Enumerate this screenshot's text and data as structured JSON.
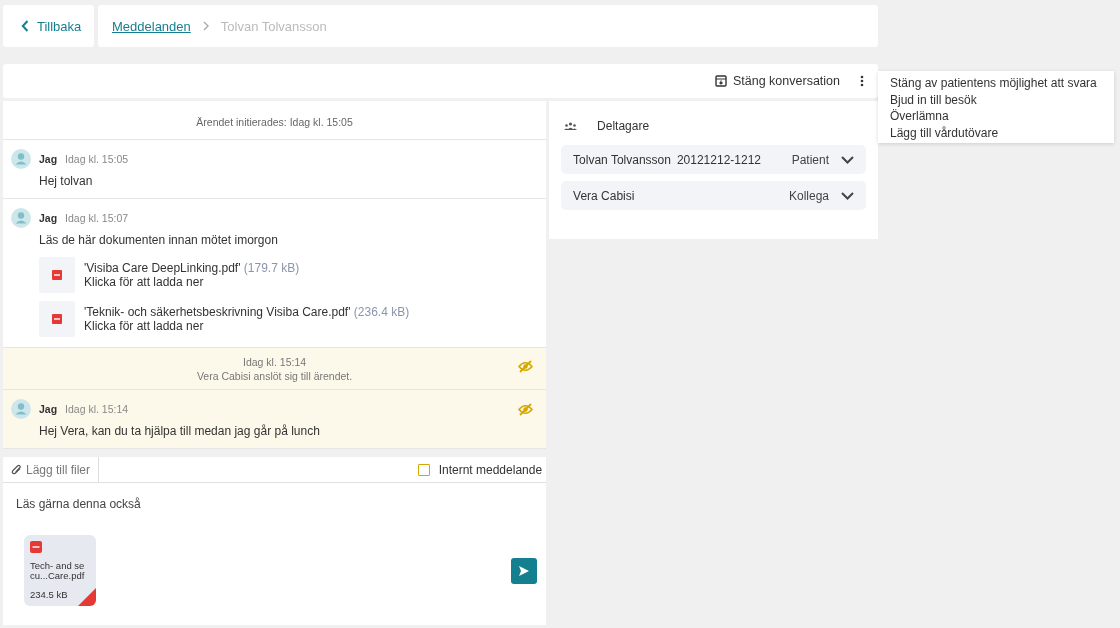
{
  "back": {
    "label": "Tillbaka"
  },
  "breadcrumb": [
    {
      "label": "Meddelanden",
      "kind": "link"
    },
    {
      "label": "Tolvan Tolvansson",
      "kind": "current"
    }
  ],
  "toolbar": {
    "close_label": "Stäng konversation"
  },
  "menu": [
    "Stäng av patientens möjlighet att svara",
    "Bjud in till besök",
    "Överlämna",
    "Lägg till vårdutövare"
  ],
  "conversation": [
    {
      "kind": "system",
      "text": "Ärendet initierades: Idag kl. 15:05",
      "internal": false
    },
    {
      "kind": "message",
      "sender": "Jag",
      "time": "Idag kl. 15:05",
      "text": "Hej tolvan",
      "internal": false
    },
    {
      "kind": "message",
      "sender": "Jag",
      "time": "Idag kl. 15:07",
      "text": "Läs de här dokumenten innan mötet imorgon",
      "internal": false,
      "attachments": [
        {
          "name": "'Visiba Care DeepLinking.pdf'",
          "size": "(179.7 kB)",
          "action": "Klicka för att ladda ner"
        },
        {
          "name": "'Teknik- och säkerhetsbeskrivning Visiba Care.pdf'",
          "size": "(236.4 kB)",
          "action": "Klicka för att ladda ner"
        }
      ]
    },
    {
      "kind": "event",
      "time": "Idag kl. 15:14",
      "text": "Vera Cabisi anslöt sig till ärendet.",
      "internal": true
    },
    {
      "kind": "message",
      "sender": "Jag",
      "time": "Idag kl. 15:14",
      "text": "Hej Vera, kan du ta hjälpa till medan jag går på lunch",
      "internal": true
    }
  ],
  "composer": {
    "attach_label": "Lägg till filer",
    "internal_label": "Internt meddelande",
    "internal_checked": false,
    "value": "Läs gärna denna också",
    "files": [
      {
        "name": "Tech- and secu...Care.pdf",
        "size": "234.5 kB"
      }
    ]
  },
  "participants": {
    "title": "Deltagare",
    "items": [
      {
        "name": "Tolvan Tolvansson",
        "id": "20121212-1212",
        "role": "Patient"
      },
      {
        "name": "Vera Cabisi",
        "role": "Kollega"
      }
    ]
  }
}
